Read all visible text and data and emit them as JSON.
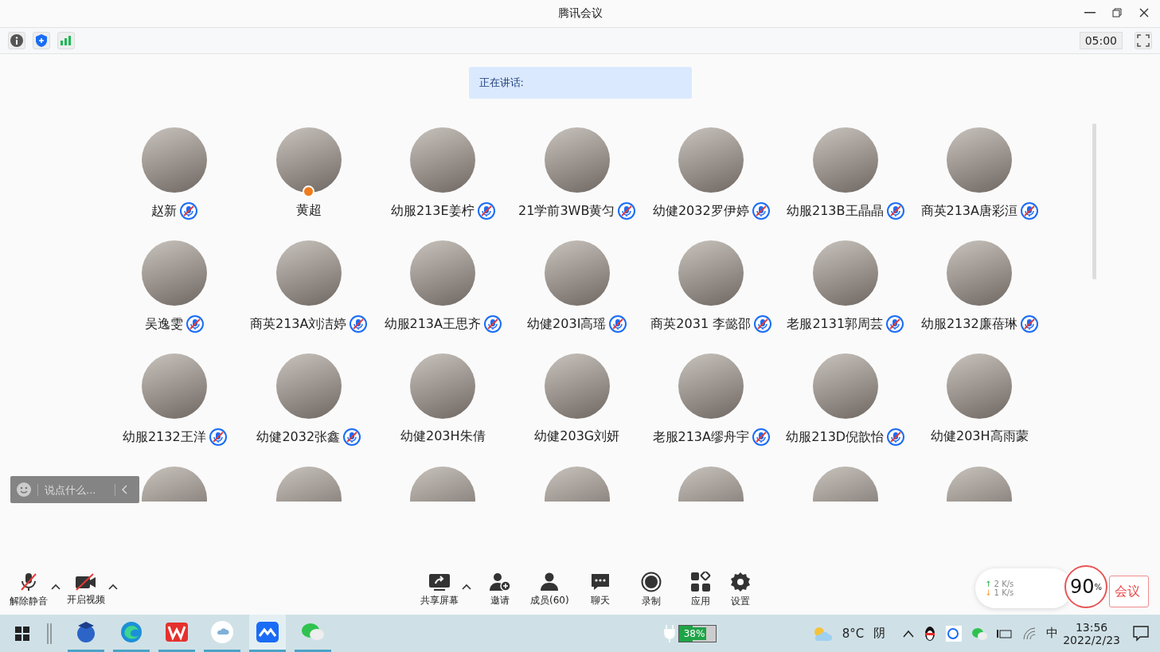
{
  "window": {
    "title": "腾讯会议"
  },
  "topbar": {
    "timer": "05:00"
  },
  "speaking": {
    "label": "正在讲话:"
  },
  "participants": [
    {
      "name": "赵新",
      "muted": true,
      "host": false
    },
    {
      "name": "黄超",
      "muted": false,
      "host": true
    },
    {
      "name": "幼服213E姜柠",
      "muted": true,
      "host": false
    },
    {
      "name": "21学前3WB黄匀",
      "muted": true,
      "host": false
    },
    {
      "name": "幼健2032罗伊婷",
      "muted": true,
      "host": false
    },
    {
      "name": "幼服213B王晶晶",
      "muted": true,
      "host": false
    },
    {
      "name": "商英213A唐彩洹",
      "muted": true,
      "host": false
    },
    {
      "name": "吴逸雯",
      "muted": true,
      "host": false
    },
    {
      "name": "商英213A刘洁婷",
      "muted": true,
      "host": false
    },
    {
      "name": "幼服213A王思齐",
      "muted": true,
      "host": false
    },
    {
      "name": "幼健203I高瑶",
      "muted": true,
      "host": false
    },
    {
      "name": "商英2031 李懿邵",
      "muted": true,
      "host": false
    },
    {
      "name": "老服2131郭周芸",
      "muted": true,
      "host": false
    },
    {
      "name": "幼服2132廉蓓琳",
      "muted": true,
      "host": false
    },
    {
      "name": "幼服2132王洋",
      "muted": true,
      "host": false
    },
    {
      "name": "幼健2032张鑫",
      "muted": true,
      "host": false
    },
    {
      "name": "幼健203H朱倩",
      "muted": false,
      "host": false
    },
    {
      "name": "幼健203G刘妍",
      "muted": false,
      "host": false
    },
    {
      "name": "老服213A缪舟宇",
      "muted": true,
      "host": false
    },
    {
      "name": "幼服213D倪歆怡",
      "muted": true,
      "host": false
    },
    {
      "name": "幼健203H高雨蒙",
      "muted": false,
      "host": false
    }
  ],
  "more_rows_below": true,
  "chat": {
    "placeholder": "说点什么..."
  },
  "controls": [
    {
      "kind": "mic",
      "label": "解除静音",
      "caret": true
    },
    {
      "kind": "video",
      "label": "开启视频",
      "caret": true
    },
    {
      "kind": "share",
      "label": "共享屏幕",
      "caret": true
    },
    {
      "kind": "invite",
      "label": "邀请",
      "caret": false
    },
    {
      "kind": "members",
      "label": "成员(60)",
      "caret": false
    },
    {
      "kind": "chat",
      "label": "聊天",
      "caret": false
    },
    {
      "kind": "record",
      "label": "录制",
      "caret": false
    },
    {
      "kind": "apps",
      "label": "应用",
      "caret": false
    },
    {
      "kind": "settings",
      "label": "设置",
      "caret": false
    }
  ],
  "leave": {
    "label": "会议"
  },
  "network": {
    "up_arrow": "↑",
    "up": "2",
    "up_unit": "K/s",
    "down_arrow": "↓",
    "down": "1",
    "down_unit": "K/s",
    "percent": "90",
    "percent_sign": "%"
  },
  "taskbar": {
    "battery": {
      "text": "38%",
      "level": 0.38
    },
    "weather": "8°C",
    "condition": "阴",
    "ime": "中",
    "time": "13:56",
    "date": "2022/2/23"
  }
}
